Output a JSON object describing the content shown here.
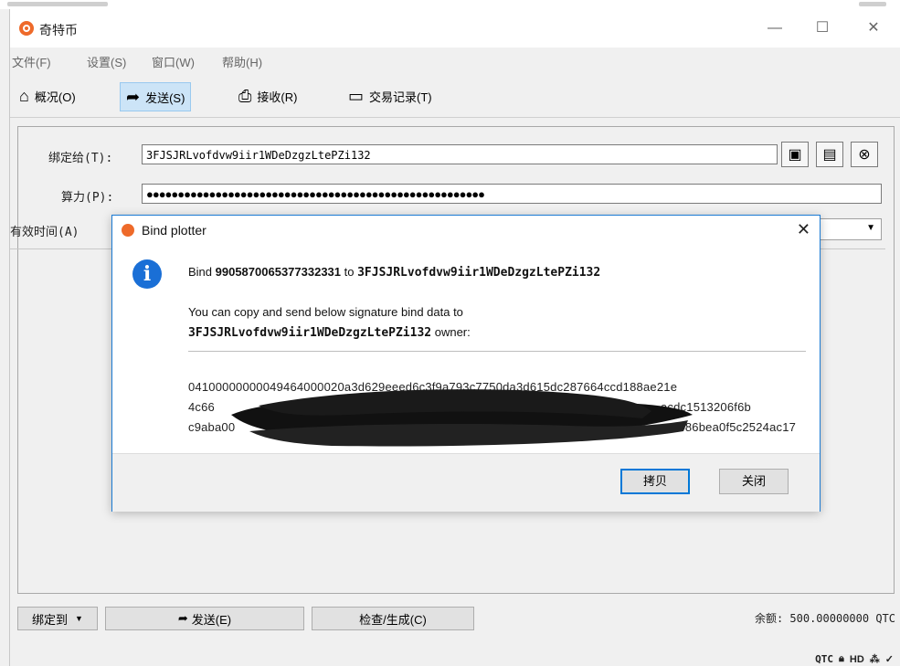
{
  "window": {
    "title": "奇特币",
    "minimize": "—",
    "maximize": "☐",
    "close": "✕"
  },
  "menu": [
    "文件(F)",
    "设置(S)",
    "窗口(W)",
    "帮助(H)"
  ],
  "toolbar": {
    "overview": "概况(O)",
    "send": "发送(S)",
    "receive": "接收(R)",
    "transactions": "交易记录(T)"
  },
  "form": {
    "bind_to_label": "绑定给(T):",
    "bind_to_value": "3FJSJRLvofdvw9iir1WDeDzgzLtePZi132",
    "power_label": "算力(P):",
    "power_value": "●●●●●●●●●●●●●●●●●●●●●●●●●●●●●●●●●●●●●●●●●●●●●●●●●●●●●●",
    "validity_label": "有效时间(A)"
  },
  "dialog": {
    "title": "Bind plotter",
    "close": "✕",
    "info_glyph": "i",
    "line1_prefix": "Bind ",
    "line1_id": "9905870065377332331",
    "line1_mid": " to ",
    "line1_addr": "3FJSJRLvofdvw9iir1WDeDzgzLtePZi132",
    "line2": "You can copy and send below signature bind data to",
    "line3_addr": "3FJSJRLvofdvw9iir1WDeDzgzLtePZi132",
    "line3_suffix": " owner:",
    "hex1": "04100000000049464000020a3d629eeed6c3f9a793c7750da3d615dc287664ccd188ae21e",
    "hex2_start": "4c66",
    "hex2_end": "acdc1513206f6b",
    "hex3_start": "c9aba00",
    "hex3_end": "2486bea0f5c2524ac17",
    "copy_button": "拷贝",
    "close_button": "关闭"
  },
  "bottom": {
    "bind_to_dropdown": "绑定到",
    "send_button": "发送(E)",
    "check_button": "检查/生成(C)",
    "balance": "余额: 500.00000000 QTC"
  },
  "status": {
    "unit": "QTC",
    "hd": "HD"
  },
  "colors": {
    "accent": "#1a7ad3",
    "brand": "#ee6a2a",
    "info": "#1a6fd6"
  }
}
